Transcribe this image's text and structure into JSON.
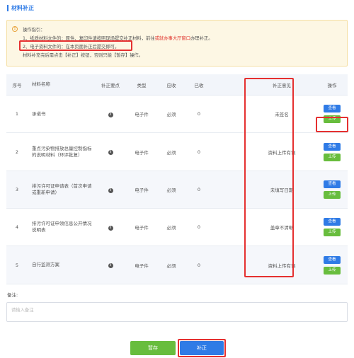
{
  "section_title": "材料补正",
  "notice": {
    "heading": "操作指引：",
    "line1_a": "1、纸质材料文件的：原件、复印件请按照现场提交补正材料，前往",
    "line1_red": "或就办事大厅窗口",
    "line1_b": "办理补正。",
    "line2": "2、电子资料文件的：在本页面补正后提交即可。",
    "line3": "材料补充完后需点击【补正】按钮，否则只能【暂存】操作。"
  },
  "table": {
    "headers": [
      "序号",
      "材料名称",
      "补正要点",
      "类型",
      "应收",
      "已收",
      "",
      "补正意见",
      "操作"
    ],
    "rows": [
      {
        "no": "1",
        "name": "承诺书",
        "type": "电子件",
        "required": "必须",
        "received": "0",
        "opinion": "未签名"
      },
      {
        "no": "2",
        "name": "重点污染物排放总量控制指标的说明材料（环评批复）",
        "type": "电子件",
        "required": "必须",
        "received": "0",
        "opinion": "资料上传有误"
      },
      {
        "no": "3",
        "name": "排污许可证申请表（首次申请或重新申请）",
        "type": "电子件",
        "required": "必须",
        "received": "0",
        "opinion": "未填写日期"
      },
      {
        "no": "4",
        "name": "排污许可证申领信息公开情况说明表",
        "type": "电子件",
        "required": "必须",
        "received": "0",
        "opinion": "盖章不清晰"
      },
      {
        "no": "5",
        "name": "自行监测方案",
        "type": "电子件",
        "required": "必须",
        "received": "0",
        "opinion": "资料上传有误"
      }
    ],
    "view_label": "查看",
    "upload_label": "上传",
    "info_glyph": "i"
  },
  "remark": {
    "label": "备注:",
    "placeholder": "请输入备注"
  },
  "buttons": {
    "save": "暂存",
    "submit": "补正"
  },
  "colors": {
    "primary": "#2f7be6",
    "success": "#68bd3d",
    "highlight": "#e53030",
    "notice_bg": "#fdf7e4"
  }
}
